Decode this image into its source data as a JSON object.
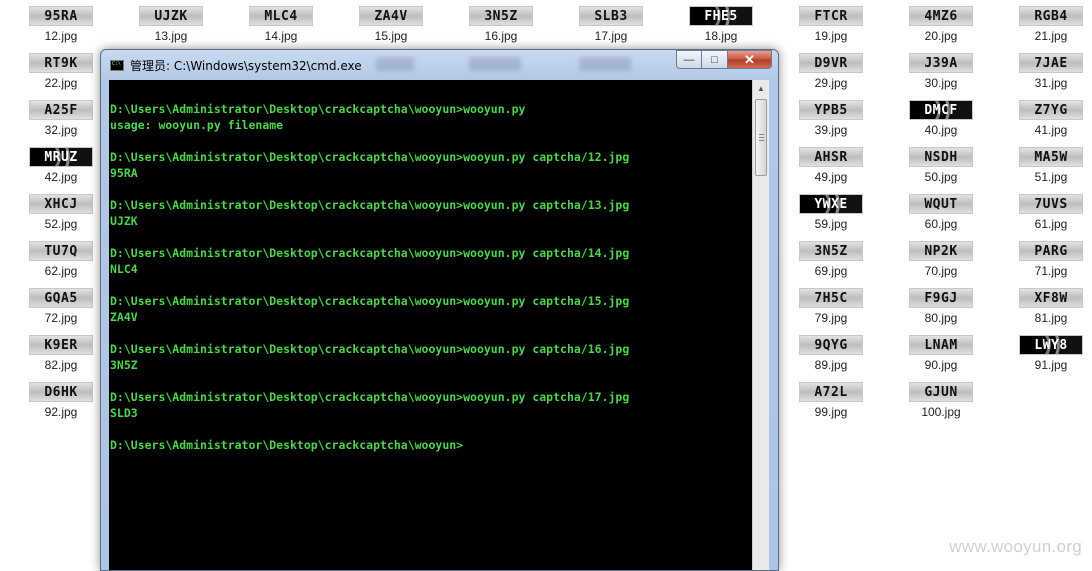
{
  "desktop": {
    "icons": [
      {
        "code": "95RA",
        "file": "12.jpg",
        "dark": false
      },
      {
        "code": "UJZK",
        "file": "13.jpg",
        "dark": false
      },
      {
        "code": "MLC4",
        "file": "14.jpg",
        "dark": false
      },
      {
        "code": "ZA4V",
        "file": "15.jpg",
        "dark": false
      },
      {
        "code": "3N5Z",
        "file": "16.jpg",
        "dark": false
      },
      {
        "code": "SLB3",
        "file": "17.jpg",
        "dark": false
      },
      {
        "code": "FHE5",
        "file": "18.jpg",
        "dark": true
      },
      {
        "code": "FTCR",
        "file": "19.jpg",
        "dark": false
      },
      {
        "code": "4MZ6",
        "file": "20.jpg",
        "dark": false
      },
      {
        "code": "RGB4",
        "file": "21.jpg",
        "dark": false
      },
      {
        "code": "RT9K",
        "file": "22.jpg",
        "dark": false
      },
      {
        "code": "D9VR",
        "file": "29.jpg",
        "dark": false
      },
      {
        "code": "J39A",
        "file": "30.jpg",
        "dark": false
      },
      {
        "code": "7JAE",
        "file": "31.jpg",
        "dark": false
      },
      {
        "code": "A25F",
        "file": "32.jpg",
        "dark": false
      },
      {
        "code": "YPB5",
        "file": "39.jpg",
        "dark": false
      },
      {
        "code": "DMCF",
        "file": "40.jpg",
        "dark": true
      },
      {
        "code": "Z7YG",
        "file": "41.jpg",
        "dark": false
      },
      {
        "code": "MRUZ",
        "file": "42.jpg",
        "dark": true
      },
      {
        "code": "AHSR",
        "file": "49.jpg",
        "dark": false
      },
      {
        "code": "NSDH",
        "file": "50.jpg",
        "dark": false
      },
      {
        "code": "MA5W",
        "file": "51.jpg",
        "dark": false
      },
      {
        "code": "XHCJ",
        "file": "52.jpg",
        "dark": false
      },
      {
        "code": "YWXE",
        "file": "59.jpg",
        "dark": true
      },
      {
        "code": "WQUT",
        "file": "60.jpg",
        "dark": false
      },
      {
        "code": "7UVS",
        "file": "61.jpg",
        "dark": false
      },
      {
        "code": "TU7Q",
        "file": "62.jpg",
        "dark": false
      },
      {
        "code": "3N5Z",
        "file": "69.jpg",
        "dark": false
      },
      {
        "code": "NP2K",
        "file": "70.jpg",
        "dark": false
      },
      {
        "code": "PARG",
        "file": "71.jpg",
        "dark": false
      },
      {
        "code": "GQA5",
        "file": "72.jpg",
        "dark": false
      },
      {
        "code": "7H5C",
        "file": "79.jpg",
        "dark": false
      },
      {
        "code": "F9GJ",
        "file": "80.jpg",
        "dark": false
      },
      {
        "code": "XF8W",
        "file": "81.jpg",
        "dark": false
      },
      {
        "code": "K9ER",
        "file": "82.jpg",
        "dark": false
      },
      {
        "code": "9QYG",
        "file": "89.jpg",
        "dark": false
      },
      {
        "code": "LNAM",
        "file": "90.jpg",
        "dark": false
      },
      {
        "code": "LWY8",
        "file": "91.jpg",
        "dark": true
      },
      {
        "code": "D6HK",
        "file": "92.jpg",
        "dark": false
      },
      {
        "code": "A72L",
        "file": "99.jpg",
        "dark": false
      },
      {
        "code": "GJUN",
        "file": "100.jpg",
        "dark": false
      }
    ]
  },
  "window": {
    "title": "管理员: C:\\Windows\\system32\\cmd.exe",
    "minimize_symbol": "—",
    "maximize_symbol": "□",
    "close_symbol": "✕"
  },
  "console": {
    "lines": [
      "D:\\Users\\Administrator\\Desktop\\crackcaptcha\\wooyun>wooyun.py",
      "usage: wooyun.py filename",
      "",
      "D:\\Users\\Administrator\\Desktop\\crackcaptcha\\wooyun>wooyun.py captcha/12.jpg",
      "95RA",
      "",
      "D:\\Users\\Administrator\\Desktop\\crackcaptcha\\wooyun>wooyun.py captcha/13.jpg",
      "UJZK",
      "",
      "D:\\Users\\Administrator\\Desktop\\crackcaptcha\\wooyun>wooyun.py captcha/14.jpg",
      "NLC4",
      "",
      "D:\\Users\\Administrator\\Desktop\\crackcaptcha\\wooyun>wooyun.py captcha/15.jpg",
      "ZA4V",
      "",
      "D:\\Users\\Administrator\\Desktop\\crackcaptcha\\wooyun>wooyun.py captcha/16.jpg",
      "3N5Z",
      "",
      "D:\\Users\\Administrator\\Desktop\\crackcaptcha\\wooyun>wooyun.py captcha/17.jpg",
      "SLD3",
      "",
      "D:\\Users\\Administrator\\Desktop\\crackcaptcha\\wooyun>"
    ]
  },
  "watermark": "www.wooyun.org"
}
